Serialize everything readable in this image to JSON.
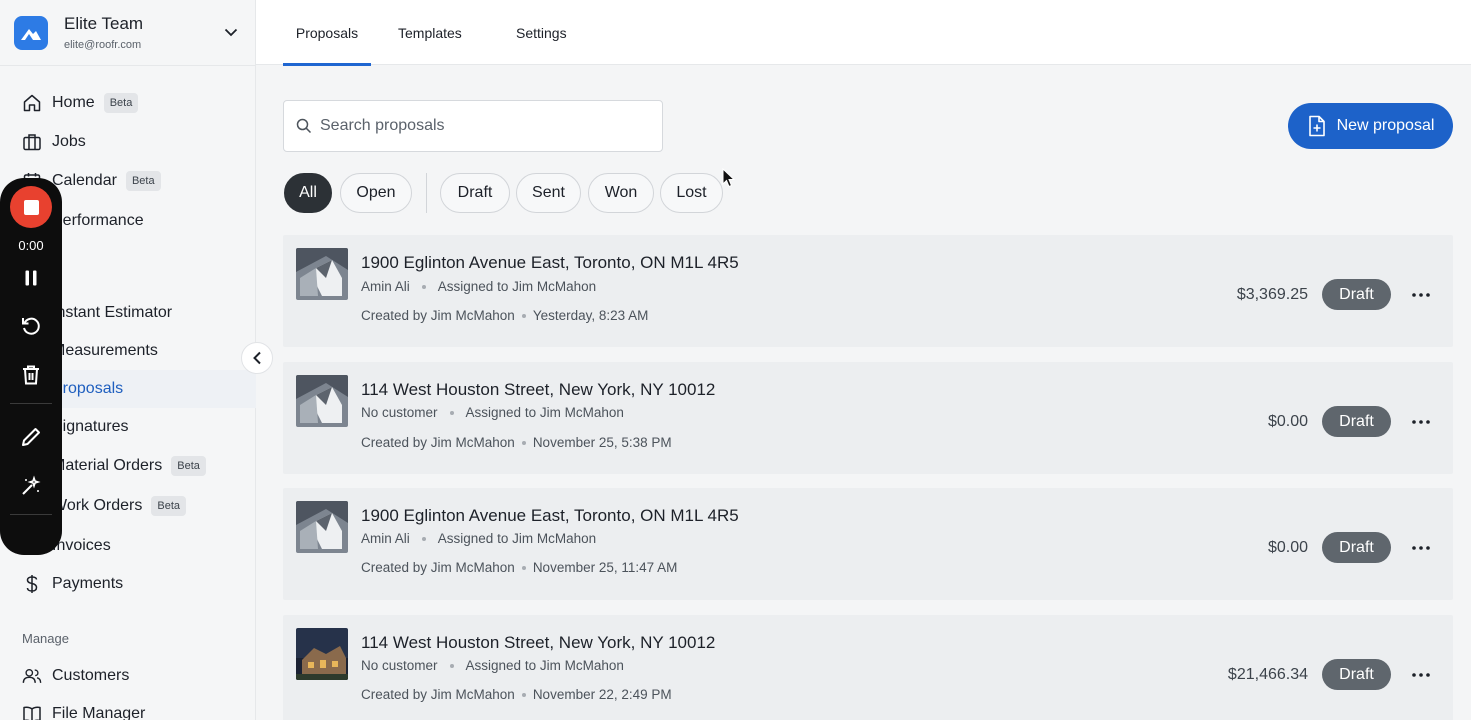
{
  "team": {
    "name": "Elite Team",
    "email": "elite@roofr.com"
  },
  "nav": {
    "home": {
      "label": "Home",
      "badge": "Beta"
    },
    "jobs": {
      "label": "Jobs"
    },
    "calendar": {
      "label": "Calendar",
      "badge": "Beta"
    },
    "performance": {
      "label": "Performance"
    },
    "instant_estimator": {
      "label": "Instant Estimator"
    },
    "measurements": {
      "label": "Measurements"
    },
    "proposals": {
      "label": "Proposals"
    },
    "signatures": {
      "label": "Signatures"
    },
    "material_orders": {
      "label": "Material Orders",
      "badge": "Beta"
    },
    "work_orders": {
      "label": "Work Orders",
      "badge": "Beta"
    },
    "invoices": {
      "label": "Invoices"
    },
    "payments": {
      "label": "Payments"
    },
    "manage_label": "Manage",
    "customers": {
      "label": "Customers"
    },
    "file_manager": {
      "label": "File Manager"
    }
  },
  "recorder": {
    "time": "0:00"
  },
  "tabs": [
    "Proposals",
    "Templates",
    "Settings"
  ],
  "search": {
    "placeholder": "Search proposals"
  },
  "new_button": "New proposal",
  "filters": [
    "All",
    "Open",
    "Draft",
    "Sent",
    "Won",
    "Lost"
  ],
  "proposals": [
    {
      "address": "1900 Eglinton Avenue East, Toronto, ON M1L 4R5",
      "customer": "Amin Ali",
      "assigned": "Assigned to Jim McMahon",
      "created_by": "Created by Jim McMahon",
      "created_at": "Yesterday, 8:23 AM",
      "amount": "$3,369.25",
      "status": "Draft"
    },
    {
      "address": "114 West Houston Street, New York, NY 10012",
      "customer": "No customer",
      "assigned": "Assigned to Jim McMahon",
      "created_by": "Created by Jim McMahon",
      "created_at": "November 25, 5:38 PM",
      "amount": "$0.00",
      "status": "Draft"
    },
    {
      "address": "1900 Eglinton Avenue East, Toronto, ON M1L 4R5",
      "customer": "Amin Ali",
      "assigned": "Assigned to Jim McMahon",
      "created_by": "Created by Jim McMahon",
      "created_at": "November 25, 11:47 AM",
      "amount": "$0.00",
      "status": "Draft"
    },
    {
      "address": "114 West Houston Street, New York, NY 10012",
      "customer": "No customer",
      "assigned": "Assigned to Jim McMahon",
      "created_by": "Created by Jim McMahon",
      "created_at": "November 22, 2:49 PM",
      "amount": "$21,466.34",
      "status": "Draft"
    }
  ]
}
